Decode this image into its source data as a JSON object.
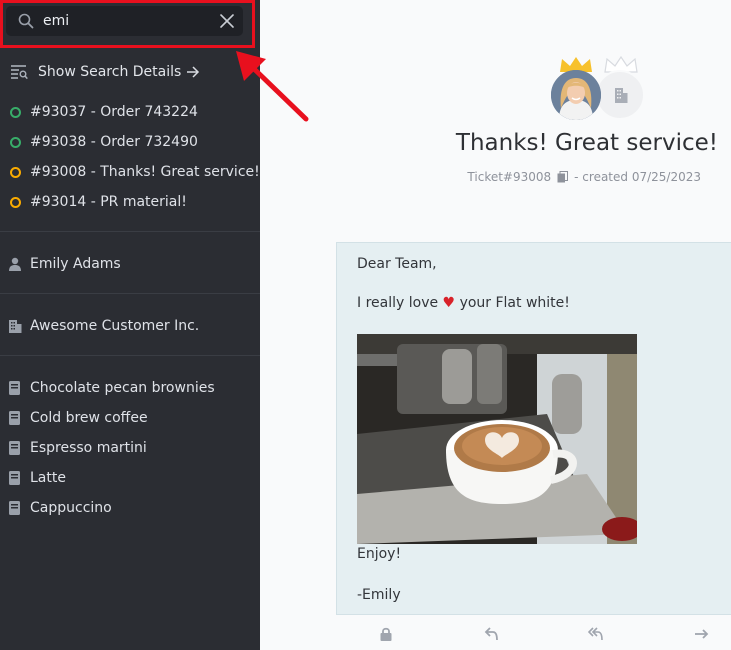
{
  "search": {
    "value": "emi"
  },
  "show_details": {
    "label": "Show Search Details"
  },
  "tickets": [
    {
      "label": "#93037 - Order 743224",
      "status_color": "#38ad69"
    },
    {
      "label": "#93038 - Order 732490",
      "status_color": "#38ad69"
    },
    {
      "label": "#93008 - Thanks! Great service!",
      "status_color": "#faab00"
    },
    {
      "label": "#93014 - PR material!",
      "status_color": "#faab00"
    }
  ],
  "user": {
    "name": "Emily Adams"
  },
  "organization": {
    "name": "Awesome Customer Inc."
  },
  "knowledge_base": [
    "Chocolate pecan brownies",
    "Cold brew coffee",
    "Espresso martini",
    "Latte",
    "Cappuccino"
  ],
  "ticket": {
    "title": "Thanks! Great service!",
    "number": "Ticket#93008",
    "created": "- created 07/25/2023"
  },
  "article": {
    "greeting": "Dear Team,",
    "line_before": "I really love",
    "heart": "♥",
    "line_after": "your Flat white!",
    "enjoy": "Enjoy!",
    "signature": "-Emily"
  },
  "colors": {
    "sidebar_bg": "#2b2d33",
    "highlight": "#e8101e",
    "crown": "#f7c12c",
    "status_open": "#38ad69",
    "status_pending": "#faab00"
  }
}
